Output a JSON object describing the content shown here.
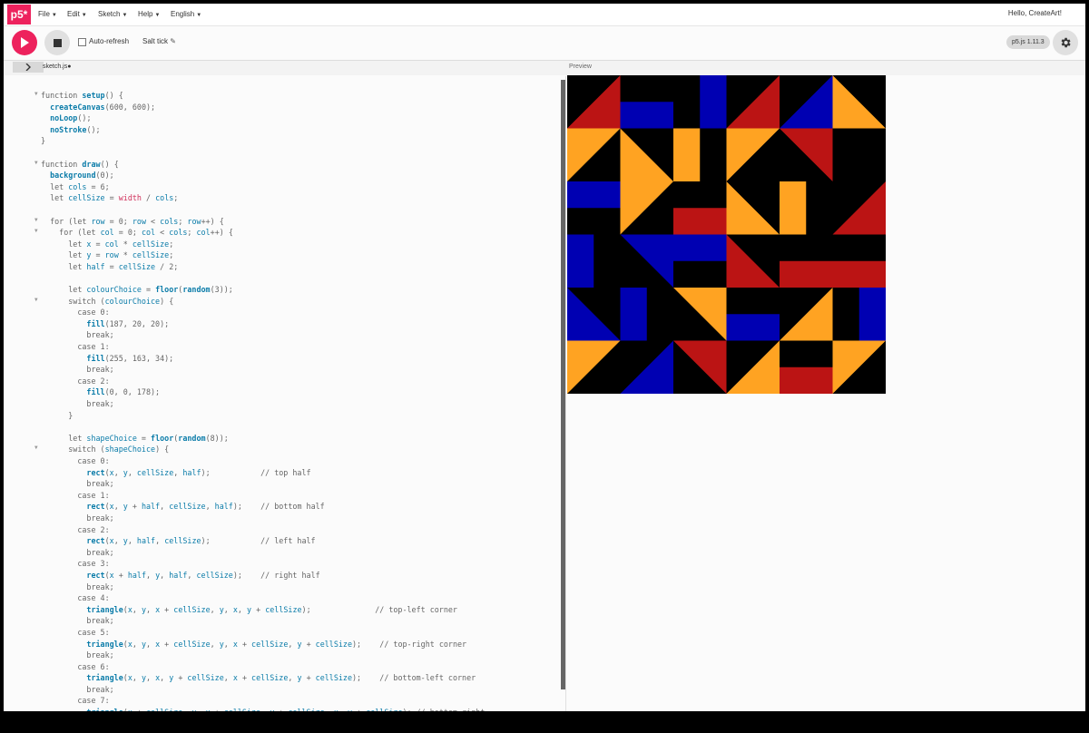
{
  "nav": {
    "logo": "p5*",
    "menus": [
      "File",
      "Edit",
      "Sketch",
      "Help",
      "English"
    ],
    "greeting": "Hello, CreateArt!"
  },
  "toolbar": {
    "auto_refresh_label": "Auto-refresh",
    "sketch_name": "Salt tick",
    "version": "p5.js 1.11.3",
    "auto_refresh_checked": false
  },
  "editor": {
    "file_tab": "sketch.js",
    "unsaved": true,
    "lines": [
      "function setup() {",
      "  createCanvas(600, 600);",
      "  noLoop();",
      "  noStroke();",
      "}",
      "",
      "function draw() {",
      "  background(0);",
      "  let cols = 6;",
      "  let cellSize = width / cols;",
      "",
      "  for (let row = 0; row < cols; row++) {",
      "    for (let col = 0; col < cols; col++) {",
      "      let x = col * cellSize;",
      "      let y = row * cellSize;",
      "      let half = cellSize / 2;",
      "",
      "      let colourChoice = floor(random(3));",
      "      switch (colourChoice) {",
      "        case 0:",
      "          fill(187, 20, 20);",
      "          break;",
      "        case 1:",
      "          fill(255, 163, 34);",
      "          break;",
      "        case 2:",
      "          fill(0, 0, 178);",
      "          break;",
      "      }",
      "",
      "      let shapeChoice = floor(random(8));",
      "      switch (shapeChoice) {",
      "        case 0:",
      "          rect(x, y, cellSize, half);           // top half",
      "          break;",
      "        case 1:",
      "          rect(x, y + half, cellSize, half);    // bottom half",
      "          break;",
      "        case 2:",
      "          rect(x, y, half, cellSize);           // left half",
      "          break;",
      "        case 3:",
      "          rect(x + half, y, half, cellSize);    // right half",
      "          break;",
      "        case 4:",
      "          triangle(x, y, x + cellSize, y, x, y + cellSize);              // top-left corner",
      "          break;",
      "        case 5:",
      "          triangle(x, y, x + cellSize, y, x + cellSize, y + cellSize);    // top-right corner",
      "          break;",
      "        case 6:",
      "          triangle(x, y, x, y + cellSize, x + cellSize, y + cellSize);    // bottom-left corner",
      "          break;",
      "        case 7:",
      "          triangle(x + cellSize, y, x + cellSize, y + cellSize, x, y + cellSize); // bottom-right"
    ],
    "fold_lines": [
      1,
      7,
      12,
      13,
      19,
      32
    ]
  },
  "preview": {
    "label": "Preview",
    "colors": {
      "R": "#bb1414",
      "O": "#ffa322",
      "B": "#0000b2",
      "bg": "#000000"
    },
    "grid": [
      [
        {
          "c": "R",
          "s": 7
        },
        {
          "c": "B",
          "s": 1
        },
        {
          "c": "B",
          "s": 3
        },
        {
          "c": "R",
          "s": 7
        },
        {
          "c": "B",
          "s": 7
        },
        {
          "c": "O",
          "s": 6
        }
      ],
      [
        {
          "c": "O",
          "s": 4
        },
        {
          "c": "O",
          "s": 6
        },
        {
          "c": "O",
          "s": 2
        },
        {
          "c": "O",
          "s": 4
        },
        {
          "c": "R",
          "s": 5
        }
      ],
      [
        {
          "c": "B",
          "s": 0
        },
        {
          "c": "O",
          "s": 4
        },
        {
          "c": "R",
          "s": 1
        },
        {
          "c": "O",
          "s": 6
        },
        {
          "c": "O",
          "s": 2
        },
        {
          "c": "R",
          "s": 7
        }
      ],
      [
        {
          "c": "B",
          "s": 2
        },
        {
          "c": "B",
          "s": 5
        },
        {
          "c": "B",
          "s": 0
        },
        {
          "c": "R",
          "s": 6
        },
        {
          "c": "R",
          "s": 1
        },
        {
          "c": "R",
          "s": 1
        }
      ],
      [
        {
          "c": "B",
          "s": 6
        },
        {
          "c": "B",
          "s": 2
        },
        {
          "c": "O",
          "s": 5
        },
        {
          "c": "B",
          "s": 1
        },
        {
          "c": "O",
          "s": 7
        },
        {
          "c": "B",
          "s": 3
        }
      ],
      [
        {
          "c": "O",
          "s": 4
        },
        {
          "c": "B",
          "s": 7
        },
        {
          "c": "R",
          "s": 5
        },
        {
          "c": "O",
          "s": 7
        },
        {
          "c": "R",
          "s": 1
        },
        {
          "c": "O",
          "s": 4
        }
      ]
    ]
  }
}
